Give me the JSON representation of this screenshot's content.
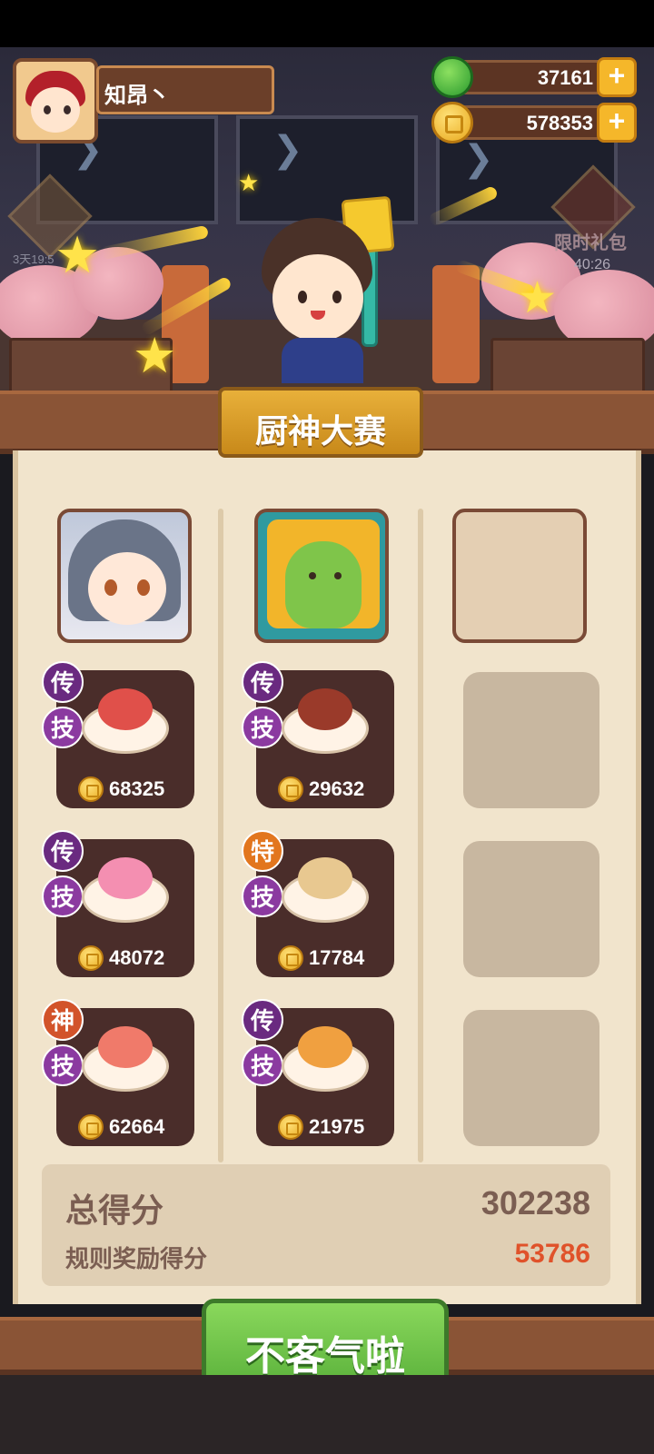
{
  "player": {
    "name": "知昂丶"
  },
  "resources": {
    "gems": "37161",
    "coins": "578353"
  },
  "events": {
    "left_badge_timer": "3天19:5",
    "gift_label": "限时礼包",
    "gift_timer": "40:26"
  },
  "contest": {
    "title": "厨神大赛"
  },
  "columns": [
    {
      "dishes": [
        {
          "rank": "传",
          "skill": "技",
          "price": "68325",
          "food_color": "#e0504a"
        },
        {
          "rank": "传",
          "skill": "技",
          "price": "48072",
          "food_color": "#f48fb1"
        },
        {
          "rank": "神",
          "skill": "技",
          "price": "62664",
          "food_color": "#f07a6a"
        }
      ]
    },
    {
      "dishes": [
        {
          "rank": "传",
          "skill": "技",
          "price": "29632",
          "food_color": "#9a3a2a"
        },
        {
          "rank": "特",
          "skill": "技",
          "price": "17784",
          "food_color": "#e8c890"
        },
        {
          "rank": "传",
          "skill": "技",
          "price": "21975",
          "food_color": "#f0a040"
        }
      ]
    },
    {
      "dishes": []
    }
  ],
  "score": {
    "total_label": "总得分",
    "total_value": "302238",
    "bonus_label": "规则奖励得分",
    "bonus_value": "53786"
  },
  "confirm_button": "不客气啦"
}
